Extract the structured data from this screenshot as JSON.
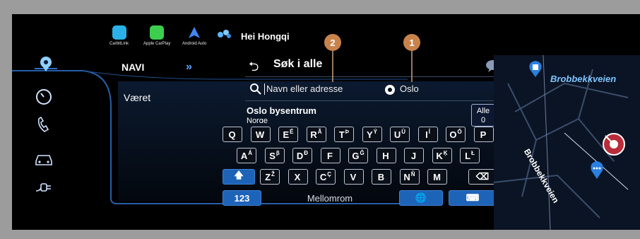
{
  "top_apps": [
    {
      "label": "CarbitLink",
      "color": "#2bb0e8"
    },
    {
      "label": "Apple CarPlay",
      "color": "#3ccf4e"
    },
    {
      "label": "Android Auto",
      "color": "#4285f4"
    }
  ],
  "assistant": {
    "label": "Hei Hongqi"
  },
  "sidebar": {
    "items": [
      {
        "icon": "navigation-icon"
      },
      {
        "icon": "speedometer-icon"
      },
      {
        "icon": "phone-icon"
      },
      {
        "icon": "car-icon"
      },
      {
        "icon": "charging-icon"
      }
    ]
  },
  "menu": {
    "items": [
      {
        "label": "NAVI",
        "active": true
      },
      {
        "label": "Været",
        "active": false
      }
    ],
    "chevron": "»"
  },
  "search": {
    "back_glyph": "⮌",
    "title": "Søk i alle",
    "placeholder": "Navn eller adresse",
    "city": "Oslo"
  },
  "suggestion": {
    "name": "Oslo bysentrum",
    "country": "Norge",
    "filter_label": "Alle",
    "filter_count": "0"
  },
  "annotations": [
    {
      "label": "2"
    },
    {
      "label": "1"
    }
  ],
  "keyboard": {
    "row1": [
      {
        "k": "Q",
        "a": ""
      },
      {
        "k": "W",
        "a": ""
      },
      {
        "k": "E",
        "a": "É"
      },
      {
        "k": "R",
        "a": "Ã"
      },
      {
        "k": "T",
        "a": "Þ"
      },
      {
        "k": "Y",
        "a": "Ý"
      },
      {
        "k": "U",
        "a": "Ù"
      },
      {
        "k": "I",
        "a": "Í"
      },
      {
        "k": "O",
        "a": "Ó"
      },
      {
        "k": "P",
        "a": ""
      }
    ],
    "row2": [
      {
        "k": "A",
        "a": "Á"
      },
      {
        "k": "S",
        "a": "β"
      },
      {
        "k": "D",
        "a": "Ð"
      },
      {
        "k": "F",
        "a": ""
      },
      {
        "k": "G",
        "a": "Ğ"
      },
      {
        "k": "H",
        "a": ""
      },
      {
        "k": "J",
        "a": ""
      },
      {
        "k": "K",
        "a": "Ķ"
      },
      {
        "k": "L",
        "a": "Ł"
      }
    ],
    "row3": [
      {
        "k": "Z",
        "a": "Ž"
      },
      {
        "k": "X",
        "a": ""
      },
      {
        "k": "C",
        "a": "Ç"
      },
      {
        "k": "V",
        "a": ""
      },
      {
        "k": "B",
        "a": ""
      },
      {
        "k": "N",
        "a": "Ñ"
      },
      {
        "k": "M",
        "a": ""
      }
    ],
    "shift_glyph": "🡅",
    "delete_glyph": "⌫",
    "numbers_label": "123",
    "space_label": "Mellomrom",
    "globe_glyph": "🌐",
    "hide_glyph": "⌨"
  },
  "map": {
    "street_top": "Brobbekkveien",
    "street_side": "Brobbekkveien",
    "accent": "#2a7fe0"
  }
}
